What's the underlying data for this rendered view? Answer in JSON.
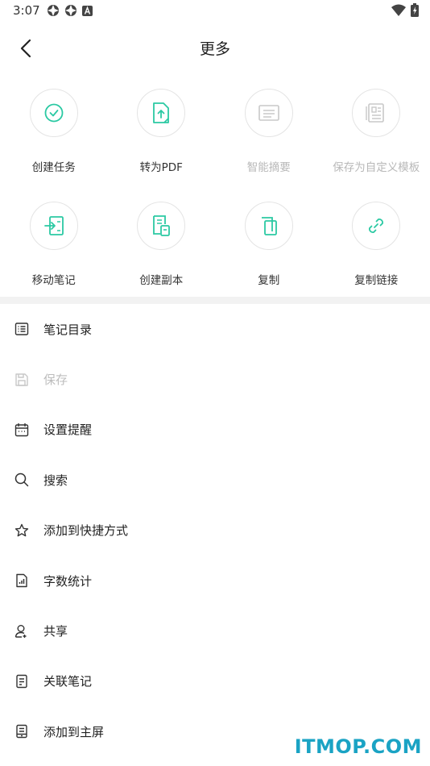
{
  "status": {
    "time": "3:07"
  },
  "header": {
    "title": "更多"
  },
  "colors": {
    "accent": "#2bc9a3",
    "disabled": "#bdbdbd",
    "icon_dark": "#333333"
  },
  "grid": [
    {
      "label": "创建任务",
      "icon": "check-circle-icon",
      "disabled": false
    },
    {
      "label": "转为PDF",
      "icon": "pdf-export-icon",
      "disabled": false
    },
    {
      "label": "智能摘要",
      "icon": "summary-icon",
      "disabled": true
    },
    {
      "label": "保存为自定义模板",
      "icon": "template-icon",
      "disabled": true
    },
    {
      "label": "移动笔记",
      "icon": "move-note-icon",
      "disabled": false
    },
    {
      "label": "创建副本",
      "icon": "duplicate-icon",
      "disabled": false
    },
    {
      "label": "复制",
      "icon": "copy-icon",
      "disabled": false
    },
    {
      "label": "复制链接",
      "icon": "link-icon",
      "disabled": false
    }
  ],
  "list": [
    {
      "label": "笔记目录",
      "icon": "toc-icon",
      "disabled": false
    },
    {
      "label": "保存",
      "icon": "save-icon",
      "disabled": true
    },
    {
      "label": "设置提醒",
      "icon": "calendar-icon",
      "disabled": false
    },
    {
      "label": "搜索",
      "icon": "search-icon",
      "disabled": false
    },
    {
      "label": "添加到快捷方式",
      "icon": "star-icon",
      "disabled": false
    },
    {
      "label": "字数统计",
      "icon": "word-count-icon",
      "disabled": false
    },
    {
      "label": "共享",
      "icon": "share-user-icon",
      "disabled": false
    },
    {
      "label": "关联笔记",
      "icon": "related-note-icon",
      "disabled": false
    },
    {
      "label": "添加到主屏",
      "icon": "home-screen-icon",
      "disabled": false
    }
  ],
  "watermark": "ITMOP.COM"
}
